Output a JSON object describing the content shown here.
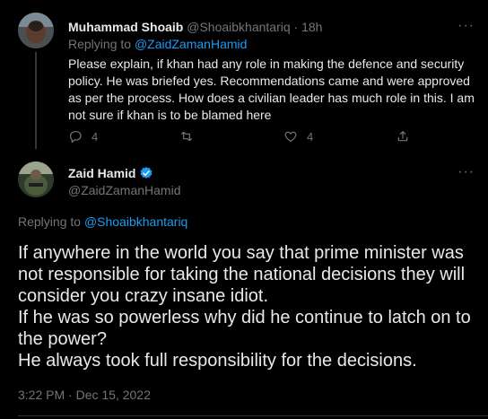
{
  "reply_tweet": {
    "author_name": "Muhammad Shoaib",
    "handle": "@Shoaibkhantariq",
    "time": "18h",
    "replying_prefix": "Replying to",
    "replying_to": "@ZaidZamanHamid",
    "text": "Please explain, if khan had any role in making the defence and security policy. He was briefed yes. Recommendations came and were approved as per the process. How does a civilian leader has much role in this. I am not sure if khan is to be blamed here",
    "reply_count": "4",
    "like_count": "4",
    "more": "···"
  },
  "main_tweet": {
    "author_name": "Zaid Hamid",
    "handle": "@ZaidZamanHamid",
    "replying_prefix": "Replying to",
    "replying_to": "@Shoaibkhantariq",
    "text": "If anywhere in the world you say that prime minister was not responsible for taking the national decisions they will consider you crazy insane idiot.\nIf he was so powerless why did he continue to latch on to the power?\nHe always took full responsibility for the decisions.",
    "timestamp": "3:22 PM · Dec 15, 2022",
    "more": "···"
  },
  "colors": {
    "accent": "#1d9bf0",
    "muted": "#71767b",
    "background": "#000000"
  }
}
